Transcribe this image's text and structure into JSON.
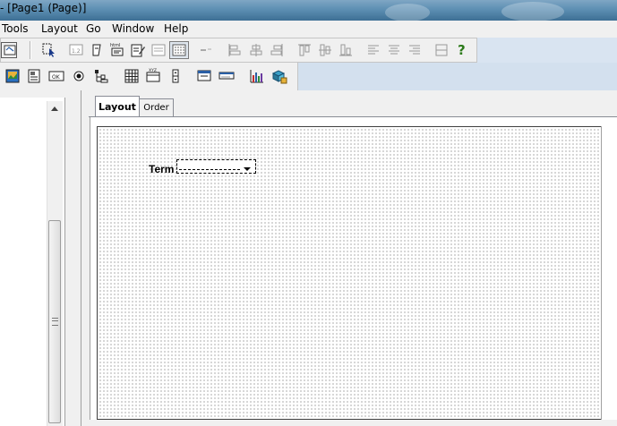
{
  "window": {
    "title": "- [Page1 (Page)]"
  },
  "menubar": {
    "items": [
      "Tools",
      "Layout",
      "Go",
      "Window",
      "Help"
    ]
  },
  "toolbar1": {
    "buttons": [
      "page-settings-icon",
      "select-tool-icon",
      "number-field-icon",
      "text-field-icon",
      "html-field-icon",
      "edit-field-icon",
      "form-icon",
      "grid-toggle-icon",
      "tab-order-icon",
      "align-left-icon",
      "align-center-icon",
      "align-right-icon",
      "align-top-icon",
      "align-middle-icon",
      "align-bottom-icon",
      "distribute-left-icon",
      "distribute-center-icon",
      "distribute-right-icon",
      "same-size-icon",
      "help-icon"
    ]
  },
  "toolbar2": {
    "buttons": [
      "image-icon",
      "document-icon",
      "ok-button-icon",
      "radio-icon",
      "tree-icon",
      "table-icon",
      "calendar-icon",
      "spinner-icon",
      "panel-icon",
      "dropdown-icon",
      "chart-icon",
      "database-icon"
    ]
  },
  "tabs": [
    {
      "label": "Layout",
      "active": true
    },
    {
      "label": "Order",
      "active": false
    }
  ],
  "form": {
    "term_label": "Term"
  },
  "colors": {
    "accent": "#3d6f94",
    "help": "#2c7a1a"
  }
}
